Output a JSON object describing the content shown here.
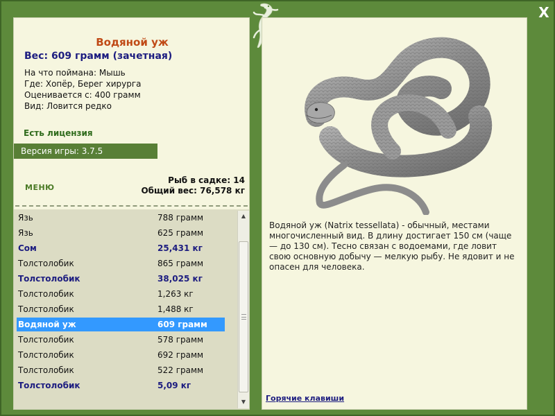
{
  "window": {
    "close_label": "X"
  },
  "fish": {
    "name": "Водяной уж",
    "weight_line": "Вес: 609 грамм (зачетная)",
    "caught_on": "На что поймана: Мышь",
    "location": "Где: Хопёр, Берег хирурга",
    "valued_from": "Оценивается с: 400 грамм",
    "rarity": "Вид: Ловится редко"
  },
  "status": {
    "license": "Есть лицензия",
    "version": "Версия игры: 3.7.5"
  },
  "menu": {
    "label": "МЕНЮ"
  },
  "keepnet": {
    "count": "Рыб в садке: 14",
    "total": "Общий вес: 76,578 кг"
  },
  "catch_list": [
    {
      "name": "Язь",
      "weight": "788 грамм",
      "trophy": false,
      "selected": false
    },
    {
      "name": "Язь",
      "weight": "625 грамм",
      "trophy": false,
      "selected": false
    },
    {
      "name": "Сом",
      "weight": "25,431 кг",
      "trophy": true,
      "selected": false
    },
    {
      "name": "Толстолобик",
      "weight": "865 грамм",
      "trophy": false,
      "selected": false
    },
    {
      "name": "Толстолобик",
      "weight": "38,025 кг",
      "trophy": true,
      "selected": false
    },
    {
      "name": "Толстолобик",
      "weight": "1,263 кг",
      "trophy": false,
      "selected": false
    },
    {
      "name": "Толстолобик",
      "weight": "1,488 кг",
      "trophy": false,
      "selected": false
    },
    {
      "name": "Водяной уж",
      "weight": "609 грамм",
      "trophy": true,
      "selected": true
    },
    {
      "name": "Толстолобик",
      "weight": "578 грамм",
      "trophy": false,
      "selected": false
    },
    {
      "name": "Толстолобик",
      "weight": "692 грамм",
      "trophy": false,
      "selected": false
    },
    {
      "name": "Толстолобик",
      "weight": "522 грамм",
      "trophy": false,
      "selected": false
    },
    {
      "name": "Толстолобик",
      "weight": "5,09 кг",
      "trophy": true,
      "selected": false
    }
  ],
  "scrollbar": {
    "up_icon": "arrow-up-icon",
    "down_icon": "arrow-down-icon"
  },
  "description": "Водяной уж (Natrix tessellata) - обычный, местами многочисленный вид. В длину достигает 150 см (чаще — до 130 см). Тесно связан с водоемами, где ловит свою основную добычу — мелкую рыбу. Не ядовит и не опасен для человека.",
  "hotkeys": {
    "label": "Горячие клавиши"
  },
  "colors": {
    "frame_green": "#5d8a3b",
    "panel_bg": "#f6f6df",
    "title_orange": "#c04a16",
    "trophy_blue": "#1d1d80",
    "selection_blue": "#3399ff"
  },
  "icons": {
    "logo": "lizard-logo-icon",
    "close": "close-icon",
    "snake": "snake-image"
  }
}
